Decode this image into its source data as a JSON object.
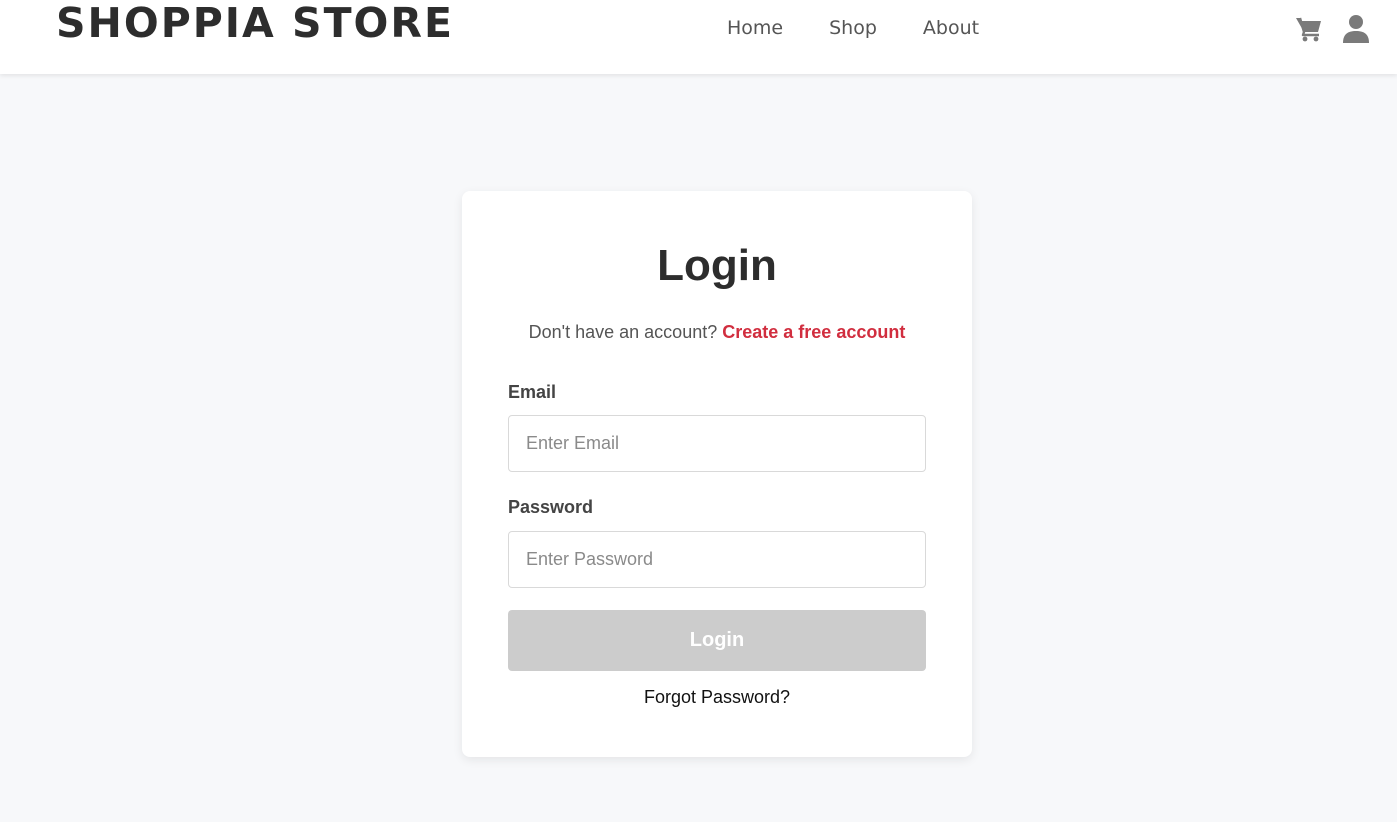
{
  "header": {
    "brand": "SHOPPIA STORE",
    "nav": {
      "home": "Home",
      "shop": "Shop",
      "about": "About"
    },
    "icons": {
      "cart": "cart-icon",
      "user": "user-icon"
    }
  },
  "login": {
    "title": "Login",
    "prompt": "Don't have an account?",
    "create_link": "Create a free account",
    "email_label": "Email",
    "email_placeholder": "Enter Email",
    "email_value": "",
    "password_label": "Password",
    "password_placeholder": "Enter Password",
    "password_value": "",
    "submit_label": "Login",
    "forgot_label": "Forgot Password?"
  },
  "colors": {
    "accent": "#d12e3f",
    "button_disabled": "#cccccc",
    "page_bg": "#f7f8fa",
    "text_dark": "#2d2d2d"
  }
}
